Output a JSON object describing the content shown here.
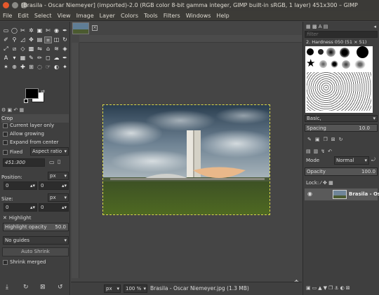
{
  "window": {
    "title": "[Brasila - Oscar Niemeyer] (imported)-2.0 (RGB color 8-bit gamma integer, GIMP built-in sRGB, 1 layer) 451x300 – GIMP"
  },
  "menu": [
    "File",
    "Edit",
    "Select",
    "View",
    "Image",
    "Layer",
    "Colors",
    "Tools",
    "Filters",
    "Windows",
    "Help"
  ],
  "tool_options": {
    "title": "Crop",
    "current_layer_only": "Current layer only",
    "allow_growing": "Allow growing",
    "expand_from_center": "Expand from center",
    "fixed_label": "Fixed",
    "fixed_value": "Aspect ratio",
    "ratio_value": "451:300",
    "position_label": "Position:",
    "position_unit": "px",
    "position_x": "0",
    "position_y": "0",
    "size_label": "Size:",
    "size_unit": "px",
    "size_w": "0",
    "size_h": "0",
    "highlight": "Highlight",
    "highlight_opacity_label": "Highlight opacity",
    "highlight_opacity_value": "50.0",
    "guides_value": "No guides",
    "auto_shrink": "Auto Shrink",
    "shrink_merged": "Shrink merged"
  },
  "status": {
    "unit": "px",
    "zoom": "100 %",
    "filename": "Brasila - Oscar Niemeyer.jpg (1.3 MB)"
  },
  "brushes": {
    "filter_placeholder": "filter",
    "current_brush": "2. Hardness 050 (51 × 51)",
    "preset": "Basic,",
    "spacing_label": "Spacing",
    "spacing_value": "10.0"
  },
  "layers": {
    "mode_label": "Mode",
    "mode_value": "Normal",
    "opacity_label": "Opacity",
    "opacity_value": "100.0",
    "lock_label": "Lock:",
    "layer_name": "Brasila - Osca"
  },
  "colors": {
    "accent": "#3d6fb0",
    "selection": "#d8d84a"
  }
}
